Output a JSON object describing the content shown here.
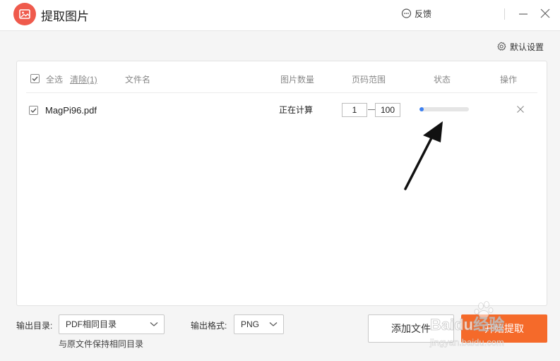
{
  "window": {
    "title": "提取图片",
    "feedback_label": "反馈",
    "icons": {
      "logo": "image-icon",
      "feedback": "chat-bubble-icon",
      "minimize": "minimize-icon",
      "close": "close-icon"
    }
  },
  "toolbar": {
    "default_settings_label": "默认设置",
    "settings_icon": "gear-icon"
  },
  "table": {
    "select_all_label": "全选",
    "clear_label": "清除(1)",
    "columns": {
      "filename": "文件名",
      "image_count": "图片数量",
      "page_range": "页码范围",
      "status": "状态",
      "actions": "操作"
    },
    "rows": [
      {
        "checked": true,
        "filename": "MagPi96.pdf",
        "image_count": "正在计算",
        "page_from": "1",
        "page_to": "100",
        "progress": 0.08
      }
    ]
  },
  "output": {
    "dir_label": "输出目录:",
    "dir_value": "PDF相同目录",
    "dir_hint": "与原文件保持相同目录",
    "format_label": "输出格式:",
    "format_value": "PNG"
  },
  "buttons": {
    "add_files": "添加文件",
    "start_extract": "开始提取"
  },
  "watermark": {
    "brand_text": "Baidu经验",
    "url_text": "jingyan.baidu.com"
  },
  "colors": {
    "accent_orange": "#f56a2a",
    "logo_red": "#ef5a4c",
    "progress_blue": "#3b7ff1"
  }
}
